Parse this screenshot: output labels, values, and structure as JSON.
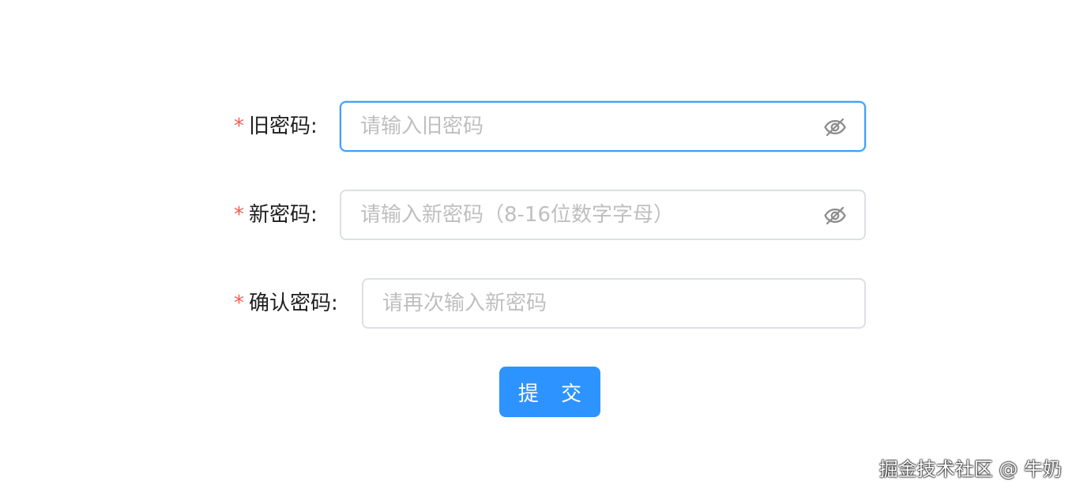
{
  "form": {
    "old_password": {
      "required_mark": "*",
      "label": "旧密码:",
      "placeholder": "请输入旧密码",
      "value": "",
      "toggle_icon": "eye-off-icon"
    },
    "new_password": {
      "required_mark": "*",
      "label": "新密码:",
      "placeholder": "请输入新密码（8-16位数字字母）",
      "value": "",
      "toggle_icon": "eye-off-icon"
    },
    "confirm_password": {
      "required_mark": "*",
      "label": "确认密码:",
      "placeholder": "请再次输入新密码",
      "value": ""
    },
    "submit_label": "提 交"
  },
  "watermark": "掘金技术社区 @ 牛奶",
  "colors": {
    "accent": "#409eff",
    "button": "#2d93ff",
    "required": "#f25c54",
    "border": "#dcdfe6",
    "placeholder": "#bfbfbf"
  }
}
